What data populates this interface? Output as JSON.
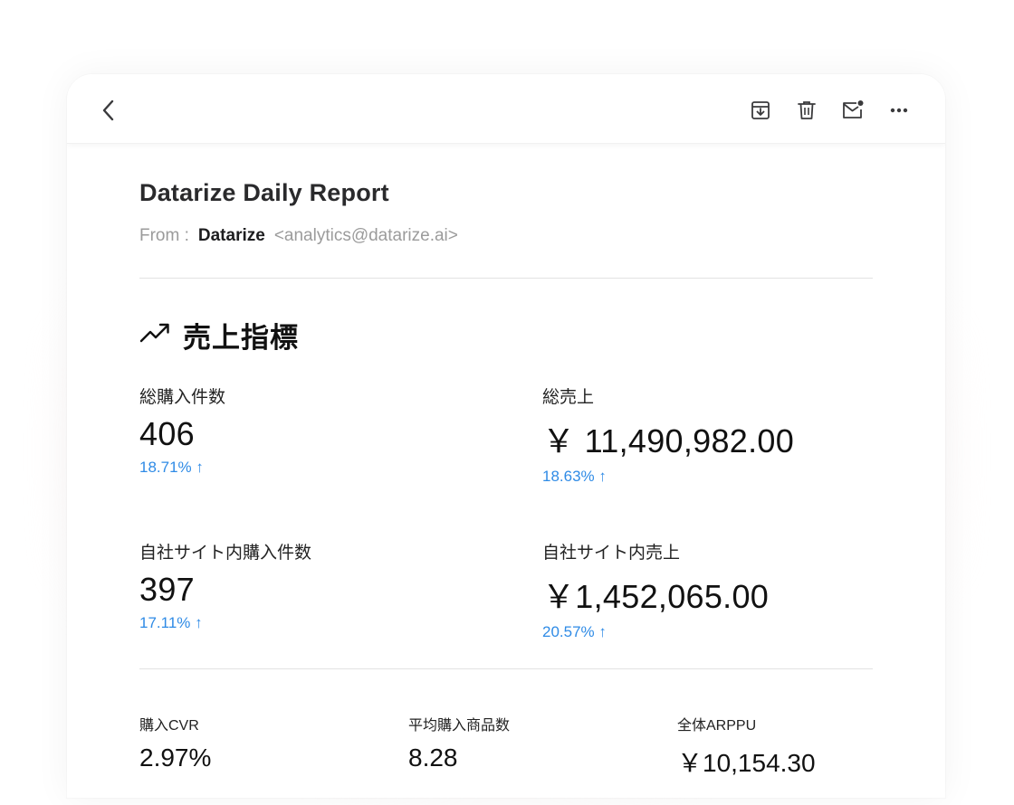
{
  "email": {
    "subject": "Datarize Daily Report",
    "from_label": "From :",
    "from_name": "Datarize",
    "from_email": "<analytics@datarize.ai>"
  },
  "toolbar": {
    "icons": [
      "back-icon",
      "archive-icon",
      "trash-icon",
      "mail-unread-icon",
      "more-icon"
    ]
  },
  "section": {
    "title": "売上指標",
    "icon": "trending-up-icon"
  },
  "metrics": [
    {
      "label": "総購入件数",
      "value": "406",
      "change": "18.71% ↑"
    },
    {
      "label": "総売上",
      "value": "￥ 11,490,982.00",
      "change": "18.63% ↑"
    },
    {
      "label": "自社サイト内購入件数",
      "value": "397",
      "change": "17.11% ↑"
    },
    {
      "label": "自社サイト内売上",
      "value": "￥1,452,065.00",
      "change": "20.57% ↑"
    }
  ],
  "small_metrics": [
    {
      "label": "購入CVR",
      "value": "2.97%"
    },
    {
      "label": "平均購入商品数",
      "value": "8.28"
    },
    {
      "label": "全体ARPPU",
      "value": "￥10,154.30"
    }
  ],
  "colors": {
    "accent": "#2f8be6",
    "text": "#1d1d1f",
    "muted": "#9b9b9b"
  }
}
